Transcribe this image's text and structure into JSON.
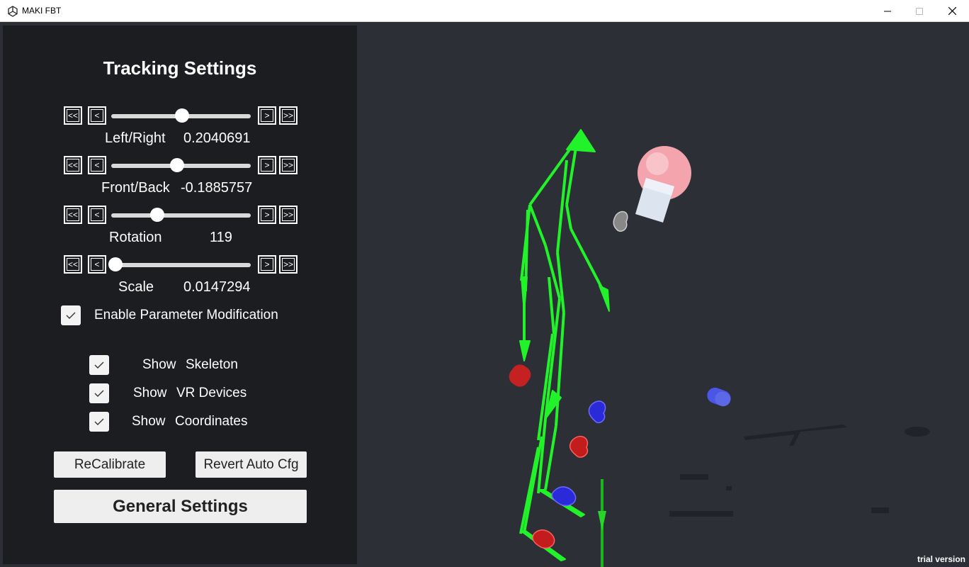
{
  "window": {
    "title": "MAKI FBT"
  },
  "panel": {
    "title": "Tracking Settings",
    "step_buttons": {
      "big_back": "<<",
      "back": "<",
      "fwd": ">",
      "big_fwd": ">>"
    },
    "sliders": [
      {
        "label": "Left/Right",
        "value": "0.2040691",
        "fraction": 0.51
      },
      {
        "label": "Front/Back",
        "value": "-0.1885757",
        "fraction": 0.47
      },
      {
        "label": "Rotation",
        "value": "119",
        "fraction": 0.33
      },
      {
        "label": "Scale",
        "value": "0.0147294",
        "fraction": 0.03
      }
    ],
    "enable_param": {
      "label": "Enable Parameter Modification",
      "checked": true
    },
    "show_skeleton": {
      "label_a": "Show",
      "label_b": "Skeleton",
      "checked": true
    },
    "show_vr": {
      "label_a": "Show",
      "label_b": "VR Devices",
      "checked": true
    },
    "show_coords": {
      "label_a": "Show",
      "label_b": "Coordinates",
      "checked": true
    },
    "recalibrate": "ReCalibrate",
    "revert": "Revert Auto Cfg",
    "general": "General Settings"
  },
  "watermark": "trial version",
  "colors": {
    "skeleton": "#22f22a",
    "panel": "#1c1d20",
    "scene": "#2c2f35"
  }
}
